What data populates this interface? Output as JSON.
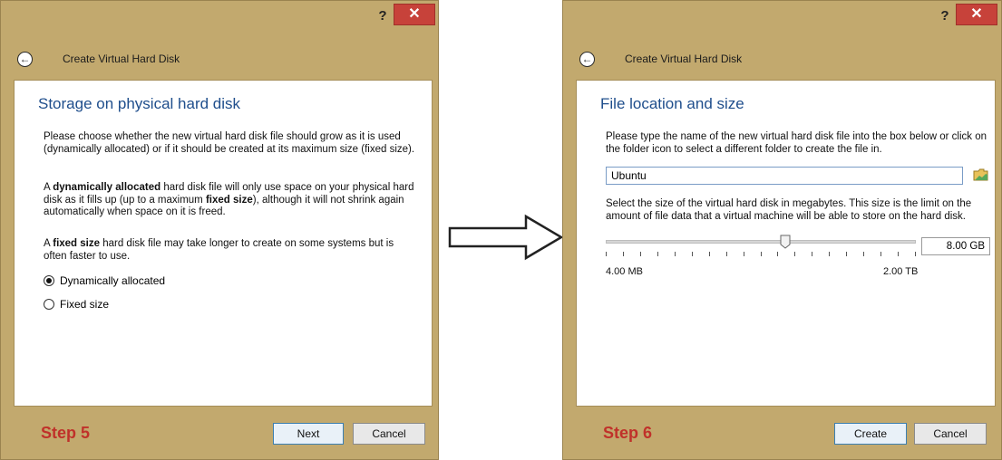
{
  "left_window": {
    "help_label": "?",
    "close_label": "✕",
    "dialog_title": "Create Virtual Hard Disk",
    "heading": "Storage on physical hard disk",
    "para1": "Please choose whether the new virtual hard disk file should grow as it is used (dynamically allocated) or if it should be created at its maximum size (fixed size).",
    "para2_parts": [
      "A ",
      "dynamically allocated",
      " hard disk file will only use space on your physical hard disk as it fills up (up to a maximum ",
      "fixed size",
      "), although it will not shrink again automatically when space on it is freed."
    ],
    "para3_parts": [
      "A ",
      "fixed size",
      " hard disk file may take longer to create on some systems but is often faster to use."
    ],
    "options": [
      {
        "label": "Dynamically allocated",
        "checked": true
      },
      {
        "label": "Fixed size",
        "checked": false
      }
    ],
    "step_label": "Step 5",
    "next_label": "Next",
    "cancel_label": "Cancel"
  },
  "right_window": {
    "help_label": "?",
    "close_label": "✕",
    "dialog_title": "Create Virtual Hard Disk",
    "heading": "File location and size",
    "para1": "Please type the name of the new virtual hard disk file into the box below or click on the folder icon to select a different folder to create the file in.",
    "file_name": "Ubuntu",
    "para2": "Select the size of the virtual hard disk in megabytes. This size is the limit on the amount of file data that a virtual machine will be able to store on the hard disk.",
    "size_value": "8.00 GB",
    "min_label": "4.00 MB",
    "max_label": "2.00 TB",
    "slider_position": 0.58,
    "step_label": "Step 6",
    "create_label": "Create",
    "cancel_label": "Cancel"
  },
  "colors": {
    "frame": "#c2a96e",
    "heading": "#1f4e8c",
    "step": "#c0312a",
    "close": "#c7423a"
  }
}
